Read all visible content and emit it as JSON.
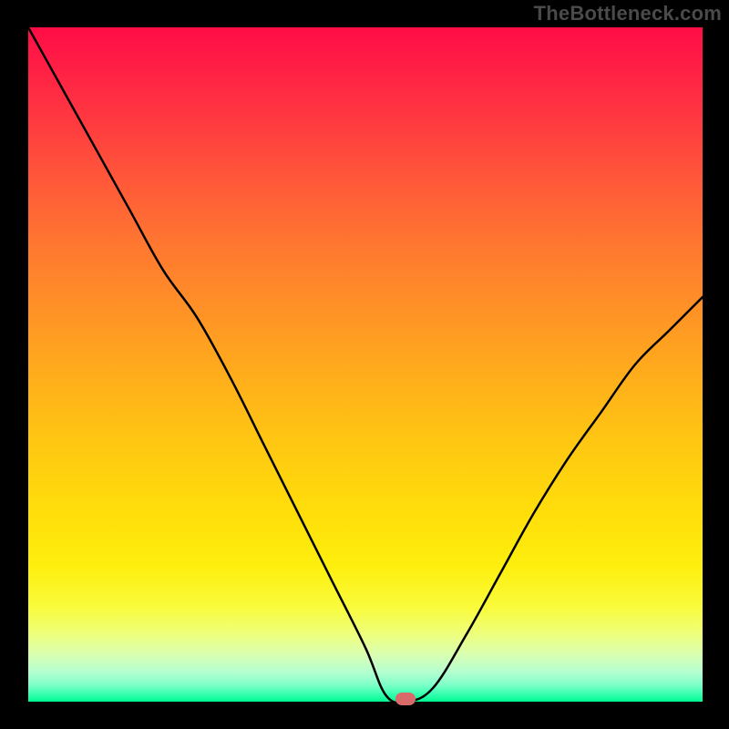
{
  "watermark": "TheBottleneck.com",
  "chart_data": {
    "type": "line",
    "title": "",
    "xlabel": "",
    "ylabel": "",
    "xlim": [
      0,
      100
    ],
    "ylim": [
      0,
      100
    ],
    "grid": false,
    "x": [
      0,
      5,
      10,
      15,
      20,
      25,
      30,
      35,
      40,
      45,
      50,
      53,
      56,
      60,
      65,
      70,
      75,
      80,
      85,
      90,
      95,
      100
    ],
    "values": [
      100,
      91,
      82,
      73,
      64,
      57,
      48,
      38,
      28,
      18,
      8,
      1,
      0,
      2,
      10,
      19,
      28,
      36,
      43,
      50,
      55,
      60
    ],
    "marker_x": 56,
    "marker_y": 0,
    "stroke_color": "#000000",
    "marker_color": "#d96a6a",
    "gradient": [
      "#ff0d46",
      "#ff9226",
      "#ffde0a",
      "#f9fb3c",
      "#00fb90"
    ]
  }
}
